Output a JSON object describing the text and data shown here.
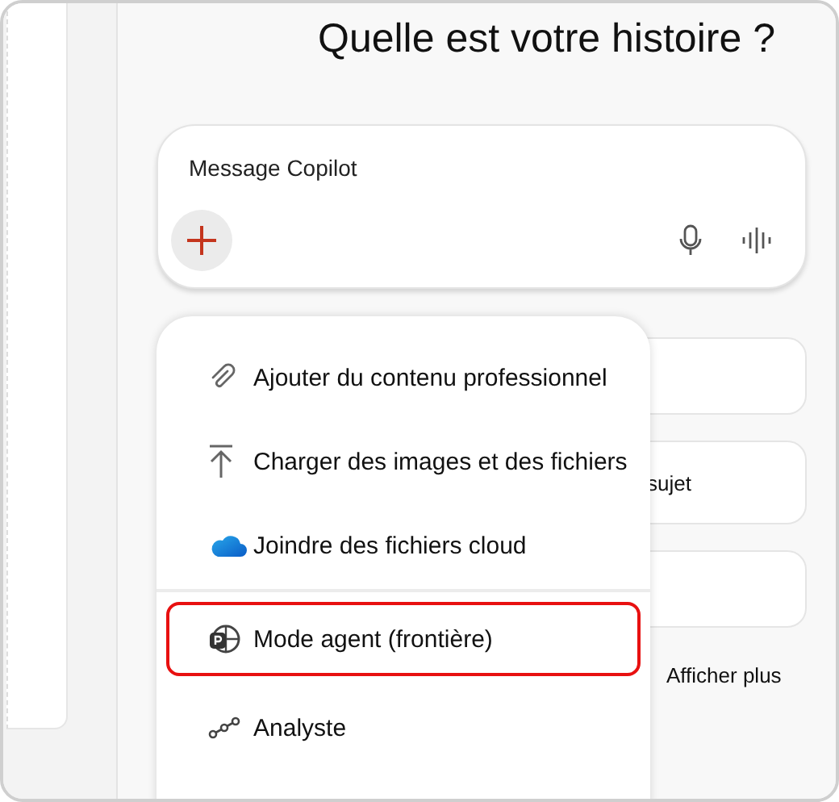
{
  "title": "Quelle est votre histoire ?",
  "composer": {
    "placeholder": "Message Copilot"
  },
  "suggestion_cards": [
    {
      "kind": "blank"
    },
    {
      "kind": "text",
      "text": "sujet"
    },
    {
      "kind": "blank"
    }
  ],
  "show_more": "Afficher plus",
  "menu": {
    "sections": [
      [
        {
          "label": "Ajouter du contenu professionnel",
          "highlighted": false
        },
        {
          "label": "Charger des images et des fichiers",
          "highlighted": false
        },
        {
          "label": "Joindre des fichiers cloud",
          "highlighted": false
        }
      ],
      [
        {
          "label": "Mode agent (frontière)",
          "highlighted": true
        },
        {
          "label": "Analyste",
          "highlighted": false
        }
      ]
    ]
  }
}
